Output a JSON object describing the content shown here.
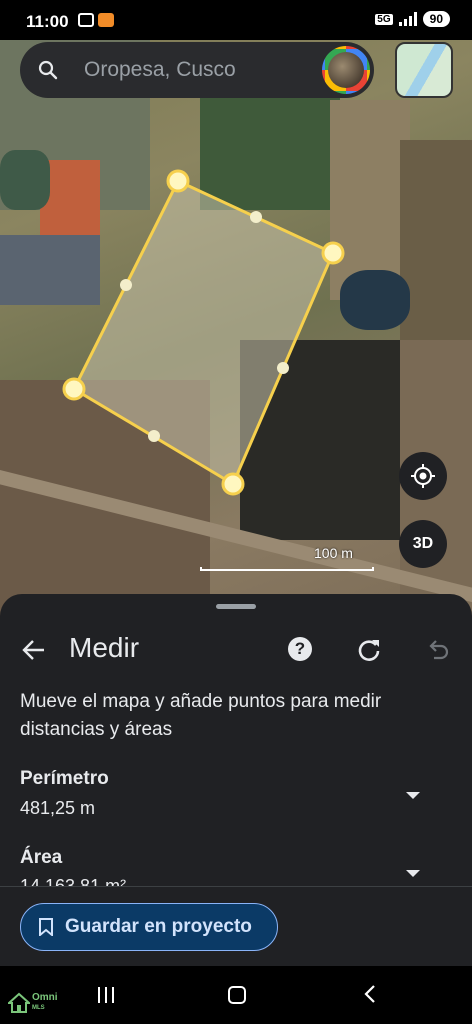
{
  "status_bar": {
    "time": "11:00",
    "network": "5G",
    "battery": "90"
  },
  "search": {
    "placeholder": "Oropesa, Cusco"
  },
  "map": {
    "scale_label": "100 m",
    "three_d_label": "3D"
  },
  "sheet": {
    "title": "Medir",
    "help_label": "?",
    "description": "Mueve el mapa y añade puntos para medir distancias y áreas",
    "perimeter": {
      "label": "Perímetro",
      "value": "481,25 m"
    },
    "area": {
      "label": "Área",
      "value": "14.163,81 m²"
    },
    "save_label": "Guardar en proyecto"
  },
  "watermark": {
    "brand": "Omni",
    "sub": "MLS"
  },
  "colors": {
    "accent": "#f6d04d",
    "button_border": "#8ab4f8"
  }
}
